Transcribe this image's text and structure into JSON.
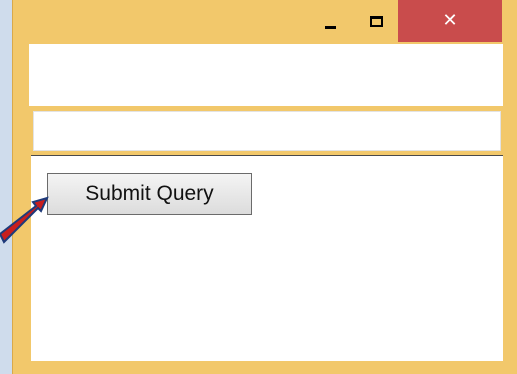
{
  "window": {
    "controls": {
      "minimize_icon": "minimize-icon",
      "maximize_icon": "maximize-icon",
      "close_glyph": "✕"
    },
    "close_color": "#c94c4c",
    "frame_color": "#f2c86b"
  },
  "form": {
    "text_field_value": "",
    "submit_label": "Submit Query"
  },
  "annotation": {
    "arrow_color": "#c81e1e",
    "arrow_icon": "arrow-pointer-icon"
  }
}
